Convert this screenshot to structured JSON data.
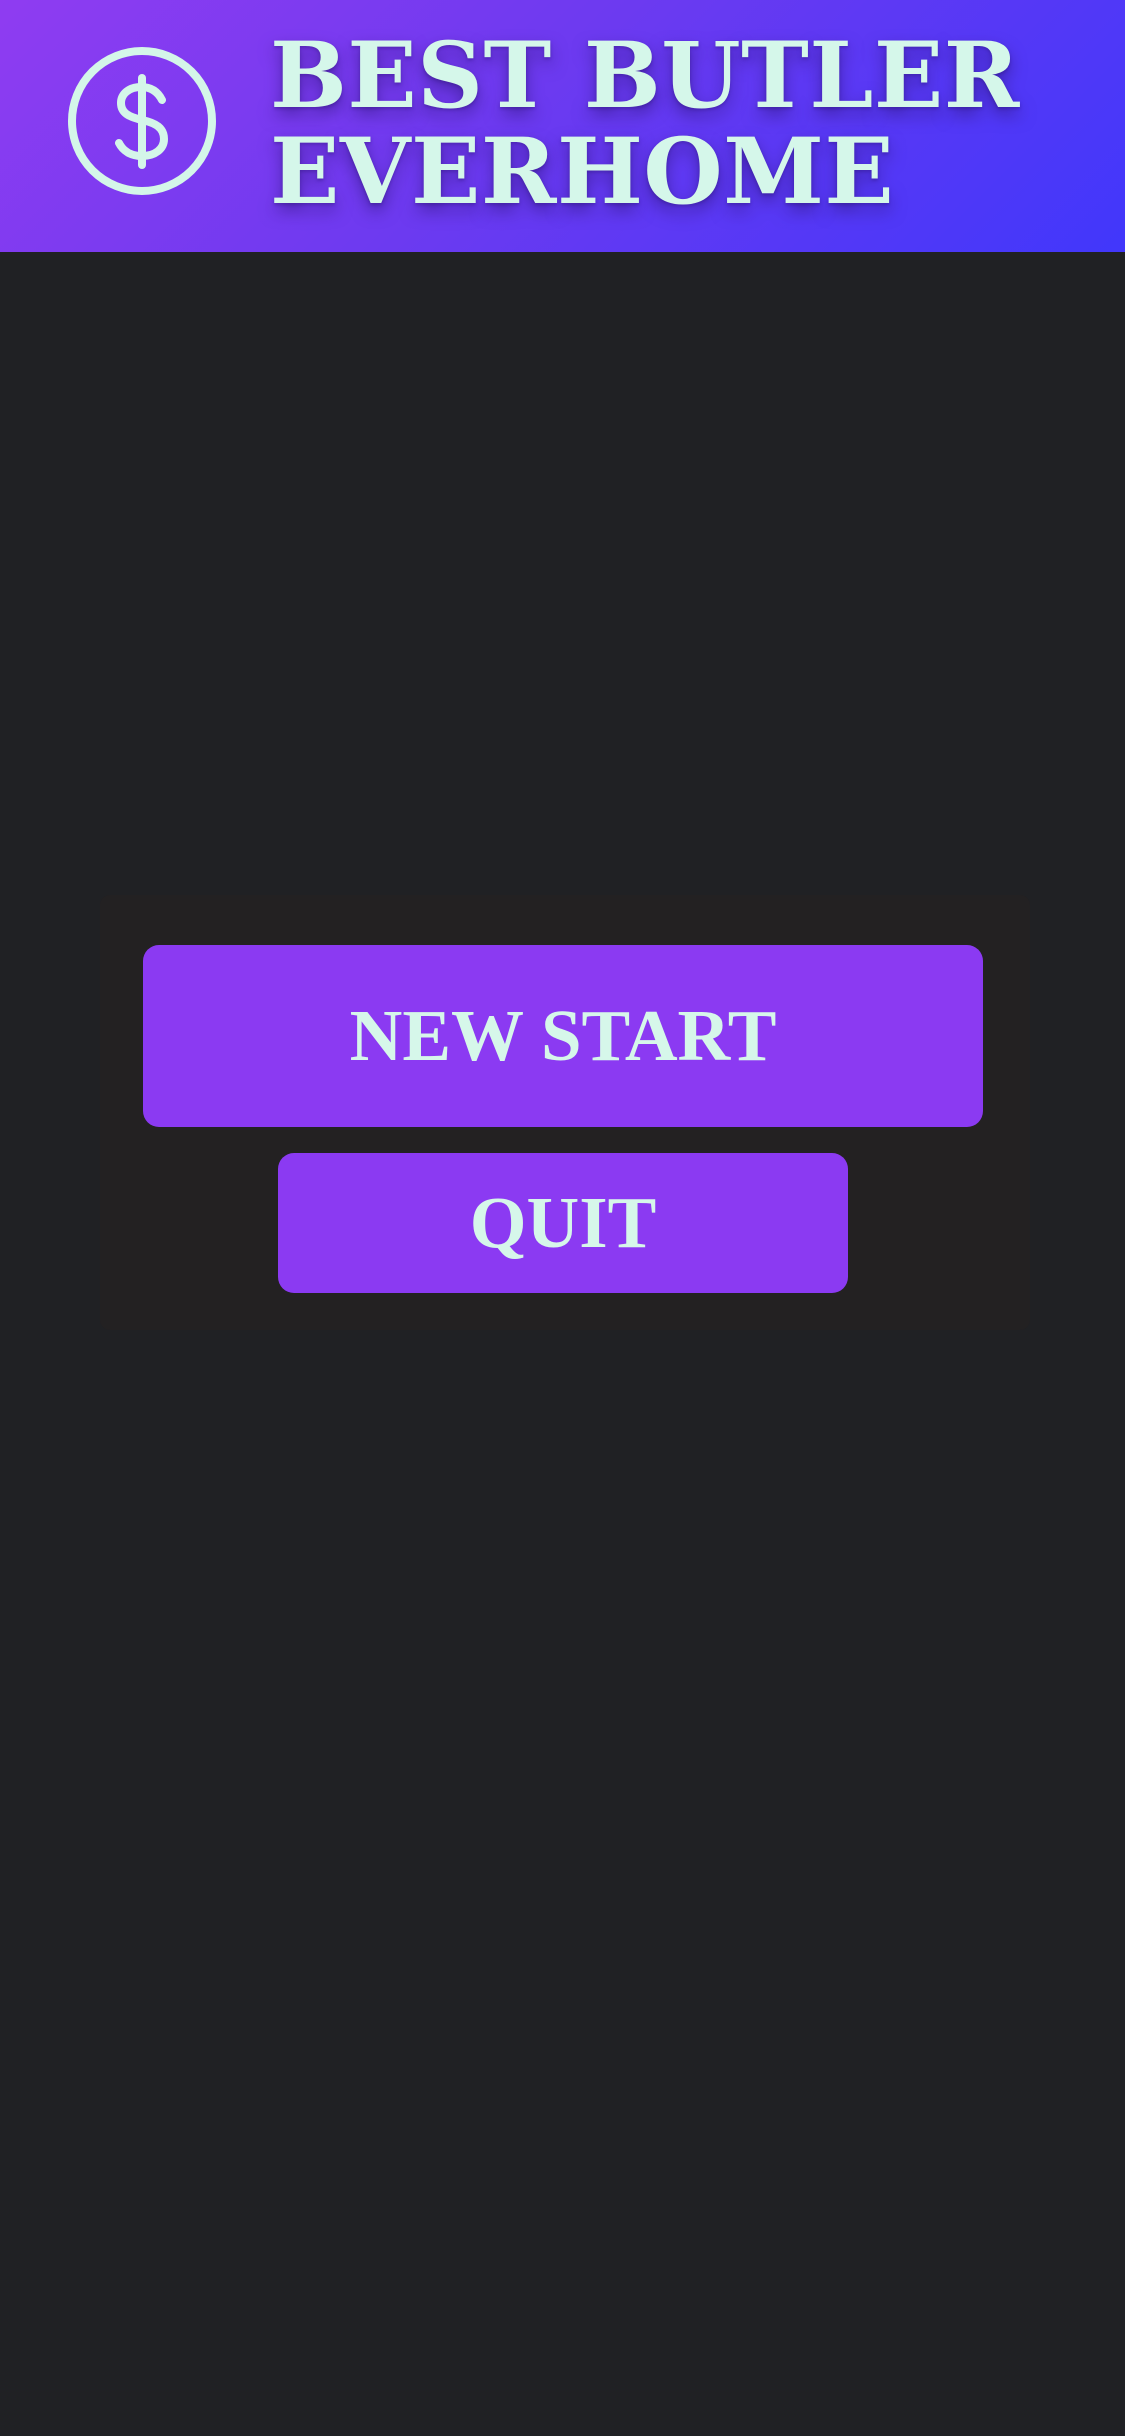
{
  "header": {
    "icon": "dollar-coin-icon",
    "title_line1": "BEST BUTLER",
    "title_line2": "EVERHOME",
    "gradient_start": "#8f3cf1",
    "gradient_end": "#4137fb"
  },
  "menu": {
    "new_start_label": "NEW START",
    "quit_label": "QUIT"
  },
  "colors": {
    "background": "#202124",
    "panel": "#232122",
    "button": "#8b3af2",
    "text_accent": "#d6f7ea"
  }
}
